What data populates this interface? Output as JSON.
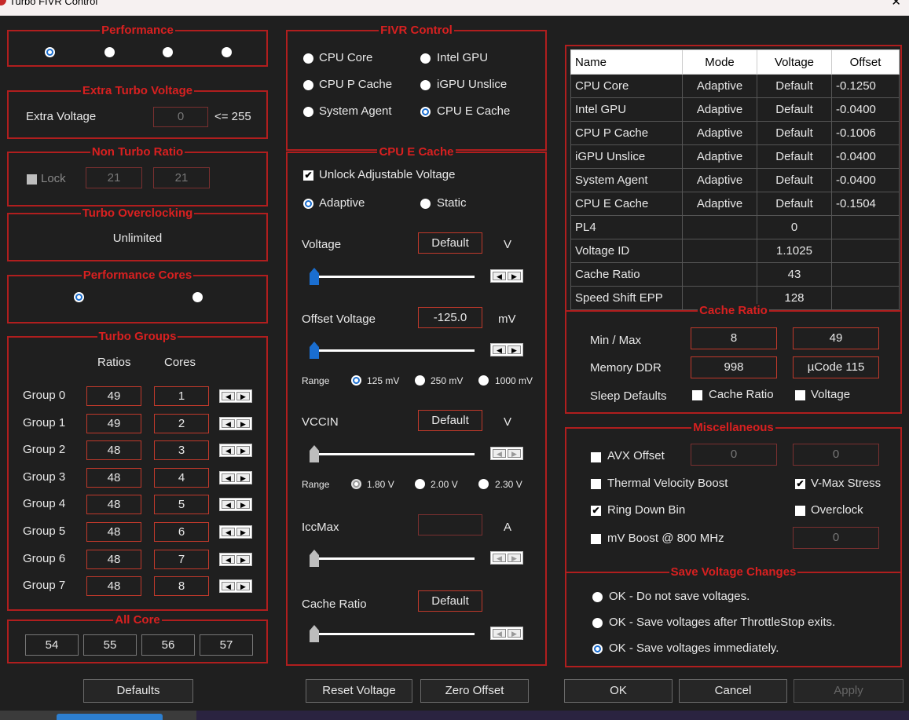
{
  "window": {
    "title": "Turbo FIVR Control",
    "close_glyph": "✕"
  },
  "performance": {
    "title": "Performance",
    "selected_index": 0
  },
  "extra_turbo": {
    "title": "Extra Turbo Voltage",
    "label": "Extra Voltage",
    "value": "0",
    "limit": "<= 255"
  },
  "non_turbo": {
    "title": "Non Turbo Ratio",
    "lock_label": "Lock",
    "value1": "21",
    "value2": "21"
  },
  "turbo_oc": {
    "title": "Turbo Overclocking",
    "value": "Unlimited"
  },
  "perf_cores": {
    "title": "Performance Cores"
  },
  "turbo_groups": {
    "title": "Turbo Groups",
    "col_ratios": "Ratios",
    "col_cores": "Cores",
    "rows": [
      {
        "label": "Group 0",
        "ratio": "49",
        "cores": "1"
      },
      {
        "label": "Group 1",
        "ratio": "49",
        "cores": "2"
      },
      {
        "label": "Group 2",
        "ratio": "48",
        "cores": "3"
      },
      {
        "label": "Group 3",
        "ratio": "48",
        "cores": "4"
      },
      {
        "label": "Group 4",
        "ratio": "48",
        "cores": "5"
      },
      {
        "label": "Group 5",
        "ratio": "48",
        "cores": "6"
      },
      {
        "label": "Group 6",
        "ratio": "48",
        "cores": "7"
      },
      {
        "label": "Group 7",
        "ratio": "48",
        "cores": "8"
      }
    ]
  },
  "all_core": {
    "title": "All Core",
    "values": [
      "54",
      "55",
      "56",
      "57"
    ]
  },
  "fivr": {
    "title": "FIVR Control",
    "options": [
      "CPU Core",
      "Intel GPU",
      "CPU P Cache",
      "iGPU Unslice",
      "System Agent",
      "CPU E Cache"
    ],
    "selected": "CPU E Cache"
  },
  "cpu_e_cache": {
    "title": "CPU E Cache",
    "unlock_label": "Unlock Adjustable Voltage",
    "adaptive_label": "Adaptive",
    "static_label": "Static",
    "voltage_label": "Voltage",
    "voltage_value": "Default",
    "voltage_unit": "V",
    "offset_label": "Offset Voltage",
    "offset_value": "-125.0",
    "offset_unit": "mV",
    "range_label": "Range",
    "offset_ranges": [
      "125 mV",
      "250 mV",
      "1000 mV"
    ],
    "vccin_label": "VCCIN",
    "vccin_value": "Default",
    "vccin_unit": "V",
    "vccin_ranges": [
      "1.80 V",
      "2.00 V",
      "2.30 V"
    ],
    "iccmax_label": "IccMax",
    "iccmax_value": "",
    "iccmax_unit": "A",
    "cache_ratio_label": "Cache Ratio",
    "cache_ratio_value": "Default"
  },
  "voltage_table": {
    "headers": [
      "Name",
      "Mode",
      "Voltage",
      "Offset"
    ],
    "rows": [
      {
        "name": "CPU Core",
        "mode": "Adaptive",
        "voltage": "Default",
        "offset": "-0.1250"
      },
      {
        "name": "Intel GPU",
        "mode": "Adaptive",
        "voltage": "Default",
        "offset": "-0.0400"
      },
      {
        "name": "CPU P Cache",
        "mode": "Adaptive",
        "voltage": "Default",
        "offset": "-0.1006"
      },
      {
        "name": "iGPU Unslice",
        "mode": "Adaptive",
        "voltage": "Default",
        "offset": "-0.0400"
      },
      {
        "name": "System Agent",
        "mode": "Adaptive",
        "voltage": "Default",
        "offset": "-0.0400"
      },
      {
        "name": "CPU E Cache",
        "mode": "Adaptive",
        "voltage": "Default",
        "offset": "-0.1504"
      },
      {
        "name": "PL4",
        "mode": "",
        "voltage": "0",
        "offset": ""
      },
      {
        "name": "Voltage ID",
        "mode": "",
        "voltage": "1.1025",
        "offset": ""
      },
      {
        "name": "Cache Ratio",
        "mode": "",
        "voltage": "43",
        "offset": ""
      },
      {
        "name": "Speed Shift EPP",
        "mode": "",
        "voltage": "128",
        "offset": ""
      }
    ]
  },
  "cache_ratio": {
    "title": "Cache Ratio",
    "minmax_label": "Min / Max",
    "min": "8",
    "max": "49",
    "memory_label": "Memory DDR",
    "memory_value": "998",
    "ucode": "µCode 115",
    "sleep_label": "Sleep Defaults",
    "sleep_cache_label": "Cache Ratio",
    "sleep_voltage_label": "Voltage"
  },
  "misc": {
    "title": "Miscellaneous",
    "avx_label": "AVX Offset",
    "avx_val1": "0",
    "avx_val2": "0",
    "tvb_label": "Thermal Velocity Boost",
    "vmax_label": "V-Max Stress",
    "ring_label": "Ring Down Bin",
    "overclock_label": "Overclock",
    "mvboost_label": "mV Boost @ 800 MHz",
    "mvboost_value": "0"
  },
  "save": {
    "title": "Save Voltage Changes",
    "opt1": "OK - Do not save voltages.",
    "opt2": "OK - Save voltages after ThrottleStop exits.",
    "opt3": "OK - Save voltages immediately."
  },
  "buttons": {
    "defaults": "Defaults",
    "reset_voltage": "Reset Voltage",
    "zero_offset": "Zero Offset",
    "ok": "OK",
    "cancel": "Cancel",
    "apply": "Apply"
  },
  "icons": {
    "arrow_left": "◀",
    "arrow_right": "▶",
    "check": "✔"
  }
}
